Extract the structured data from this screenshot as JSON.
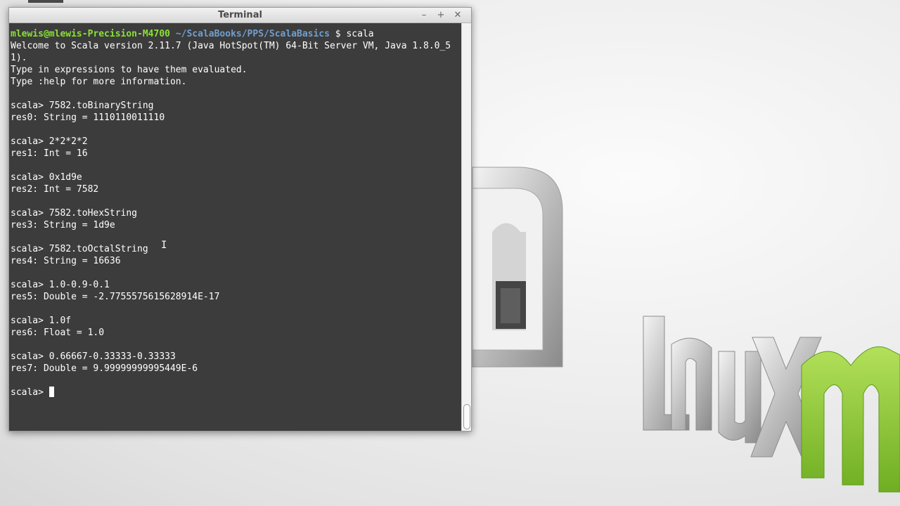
{
  "window": {
    "title": "Terminal",
    "minimize_icon": "minimize-icon",
    "maximize_icon": "maximize-icon",
    "close_icon": "close-icon"
  },
  "terminal": {
    "prompt_user": "mlewis@mlewis-Precision-M4700",
    "prompt_path": "~/ScalaBooks/PPS/ScalaBasics",
    "prompt_cmd": " $ scala",
    "lines": [
      "Welcome to Scala version 2.11.7 (Java HotSpot(TM) 64-Bit Server VM, Java 1.8.0_5",
      "1).",
      "Type in expressions to have them evaluated.",
      "Type :help for more information.",
      "",
      "scala> 7582.toBinaryString",
      "res0: String = 1110110011110",
      "",
      "scala> 2*2*2*2",
      "res1: Int = 16",
      "",
      "scala> 0x1d9e",
      "res2: Int = 7582",
      "",
      "scala> 7582.toHexString",
      "res3: String = 1d9e",
      "",
      "scala> 7582.toOctalString",
      "res4: String = 16636",
      "",
      "scala> 1.0-0.9-0.1",
      "res5: Double = -2.7755575615628914E-17",
      "",
      "scala> 1.0f",
      "res6: Float = 1.0",
      "",
      "scala> 0.66667-0.33333-0.33333",
      "res7: Double = 9.99999999995449E-6",
      ""
    ],
    "current_prompt": "scala> "
  },
  "wallpaper": {
    "logo_text": "LinuX mint",
    "accent_color": "#8cc63f"
  }
}
